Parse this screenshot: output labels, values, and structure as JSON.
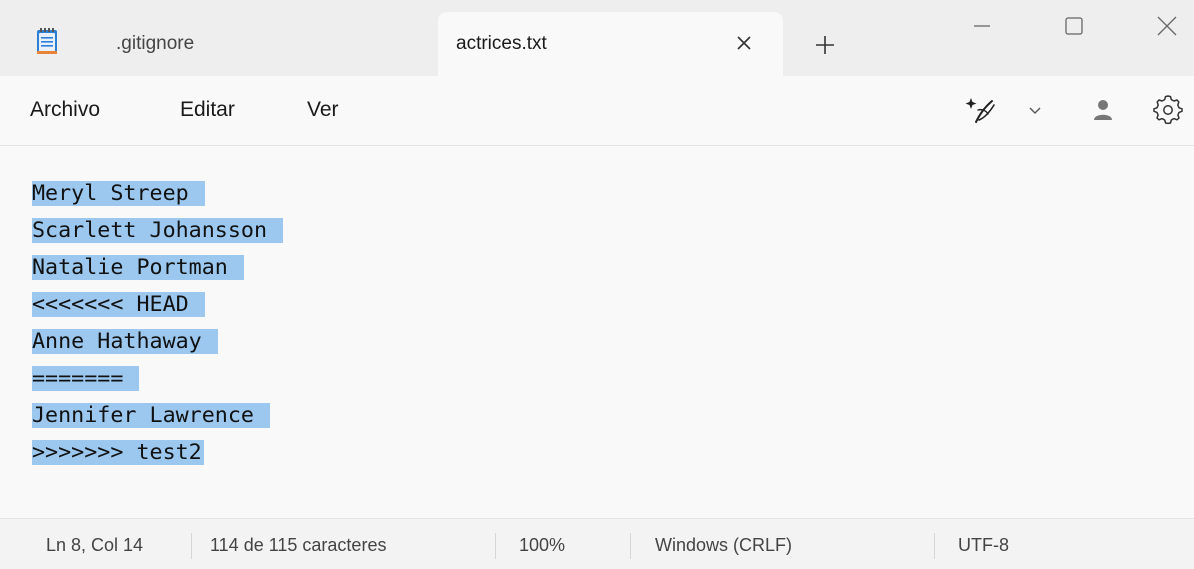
{
  "tabs": [
    {
      "label": ".gitignore",
      "active": false
    },
    {
      "label": "actrices.txt",
      "active": true
    }
  ],
  "menu": {
    "archivo": "Archivo",
    "editar": "Editar",
    "ver": "Ver"
  },
  "icons": {
    "app": "notepad-icon",
    "close_tab": "close-icon",
    "new_tab": "plus-icon",
    "minimize": "minimize-icon",
    "maximize": "maximize-icon",
    "close_window": "close-icon",
    "copilot": "copilot-sparkle-icon",
    "copilot_dropdown": "chevron-down-icon",
    "account": "account-icon",
    "settings": "gear-icon"
  },
  "editor": {
    "lines": [
      "Meryl Streep",
      "Scarlett Johansson",
      "Natalie Portman",
      "<<<<<<< HEAD",
      "Anne Hathaway",
      "=======",
      "Jennifer Lawrence",
      ">>>>>>> test2"
    ],
    "selection_color": "#9cc8ef"
  },
  "status": {
    "position": "Ln 8, Col 14",
    "characters": "114 de 115 caracteres",
    "zoom": "100%",
    "line_ending": "Windows (CRLF)",
    "encoding": "UTF-8"
  }
}
